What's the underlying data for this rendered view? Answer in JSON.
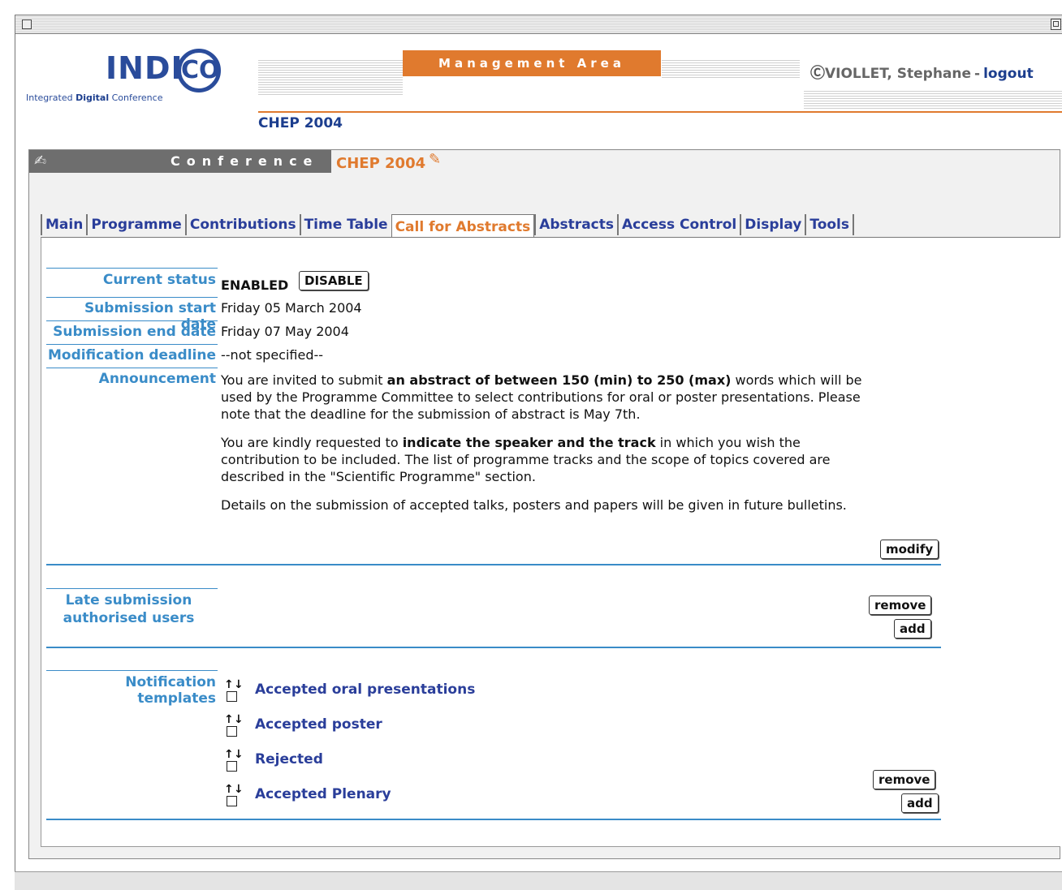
{
  "header": {
    "logo_text": "INDI",
    "logo_co": "CO",
    "logo_sub_a": "Integrated ",
    "logo_sub_b": "Digital",
    "logo_sub_c": " Conference",
    "area_label": "Management Area",
    "user_icon": "Ⓒ",
    "user_name": "VIOLLET, Stephane",
    "separator": "-",
    "logout": "logout",
    "conference": "CHEP 2004"
  },
  "conference_bar": {
    "label": "Conference",
    "name": "CHEP 2004",
    "edit_icon": "✎",
    "bar_icon": "✍"
  },
  "tabs": [
    {
      "label": "Main"
    },
    {
      "label": "Programme"
    },
    {
      "label": "Contributions"
    },
    {
      "label": "Time Table"
    },
    {
      "label": "Call for Abstracts",
      "active": true
    },
    {
      "label": "Abstracts"
    },
    {
      "label": "Access Control"
    },
    {
      "label": "Display"
    },
    {
      "label": "Tools"
    }
  ],
  "cfa": {
    "status_label": "Current status",
    "status_value": "ENABLED",
    "disable_button": "DISABLE",
    "start_label": "Submission start date",
    "start_value": "Friday 05 March 2004",
    "end_label": "Submission end date",
    "end_value": "Friday 07 May 2004",
    "modif_label": "Modification deadline",
    "modif_value": "--not specified--",
    "announcement_label": "Announcement",
    "ann_p1_a": "You are invited to submit ",
    "ann_p1_b": "an abstract of between 150 (min) to 250 (max)",
    "ann_p1_c": " words which will be used by the Programme Committee to select contributions for oral or poster presentations. Please note that the deadline for the submission of abstract is May 7th.",
    "ann_p2_a": "You are kindly requested to ",
    "ann_p2_b": "indicate the speaker and the track",
    "ann_p2_c": " in which you wish the contribution to be included. The list of programme tracks and the scope of topics covered are described in the \"Scientific Programme\" section.",
    "ann_p3": "Details on the submission of accepted talks, posters and papers will be given in future bulletins.",
    "modify_button": "modify"
  },
  "late": {
    "label_line1": "Late submission",
    "label_line2": "authorised users",
    "remove_button": "remove",
    "add_button": "add"
  },
  "notifications": {
    "label": "Notification templates",
    "items": [
      {
        "label": "Accepted oral presentations"
      },
      {
        "label": "Accepted poster"
      },
      {
        "label": "Rejected"
      },
      {
        "label": "Accepted Plenary"
      }
    ],
    "arrow_up": "↑",
    "arrow_down": "↓",
    "remove_button": "remove",
    "add_button": "add"
  }
}
